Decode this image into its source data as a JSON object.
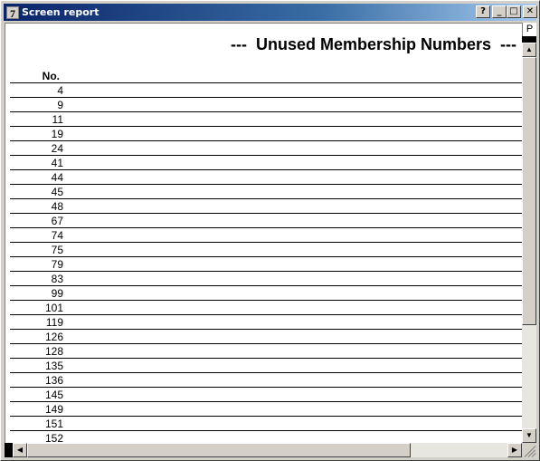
{
  "window": {
    "app_icon": "7",
    "title": "Screen report",
    "help_label": "?",
    "min_label": "_",
    "max_label": "□",
    "close_label": "✕"
  },
  "report": {
    "title": "---  Unused Membership Numbers  ---",
    "column_header": "No.",
    "rows": [
      "4",
      "9",
      "11",
      "19",
      "24",
      "41",
      "44",
      "45",
      "48",
      "67",
      "74",
      "75",
      "79",
      "83",
      "99",
      "101",
      "119",
      "126",
      "128",
      "135",
      "136",
      "145",
      "149",
      "151",
      "152"
    ]
  },
  "scrollbar": {
    "page_tab_label": "P",
    "up_arrow": "▲",
    "down_arrow": "▼",
    "left_arrow": "◀",
    "right_arrow": "▶"
  }
}
